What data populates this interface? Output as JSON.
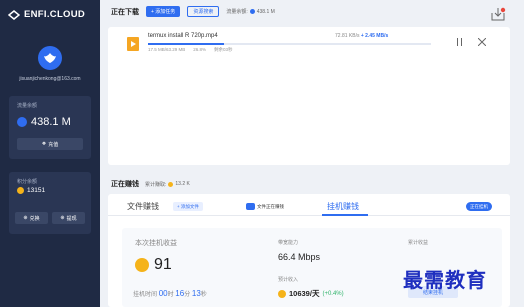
{
  "sidebar": {
    "logo": "ENFI.CLOUD",
    "email": "jisuanjichenkong@163.com",
    "balance_label": "流量余额",
    "balance_value": "438.1 M",
    "recharge_label": "充值",
    "points_label": "积分余额",
    "points_value": "13151",
    "exchange_label": "兑换",
    "withdraw_label": "提现"
  },
  "download": {
    "title": "正在下载",
    "add_task": "+ 添加任务",
    "search": "资源搜索",
    "quota_label": "流量余额:",
    "quota_value": "438.1 M",
    "task": {
      "name": "termux install R 720p.mp4",
      "size": "17.5 MB/63.29 MB",
      "percent": "26.8%",
      "status": "剩余03秒",
      "speed_down": "72.81 KB/s",
      "speed_up": "+ 2.45 MB/s",
      "progress": 0.268
    }
  },
  "earning": {
    "title": "正在赚钱",
    "sub_label": "累计赚取:",
    "sub_value": "13.2 K",
    "tabs": [
      "文件赚钱",
      "挂机赚钱"
    ],
    "add_file": "+ 添加文件",
    "sharing_chip": "文件正在赚钱",
    "hangup_chip": "正在挂机",
    "this_income_label": "本次挂机收益",
    "this_income_value": "91",
    "duration_label": "挂机时间",
    "hours": "00",
    "hours_unit": "时",
    "minutes": "16",
    "minutes_unit": "分",
    "seconds": "13",
    "seconds_unit": "秒",
    "bandwidth_label": "带宽能力",
    "bandwidth_value": "66.4 Mbps",
    "daily_label": "预计收入",
    "daily_value": "10639/天",
    "daily_rate": "(+0.4%)",
    "cumulative_label": "累计收益",
    "stop_label": "结束挂机"
  },
  "watermark": "最需教育",
  "colors": {
    "accent": "#2f6df0",
    "sidebar": "#1f2a44",
    "coin": "#f5b31a"
  }
}
